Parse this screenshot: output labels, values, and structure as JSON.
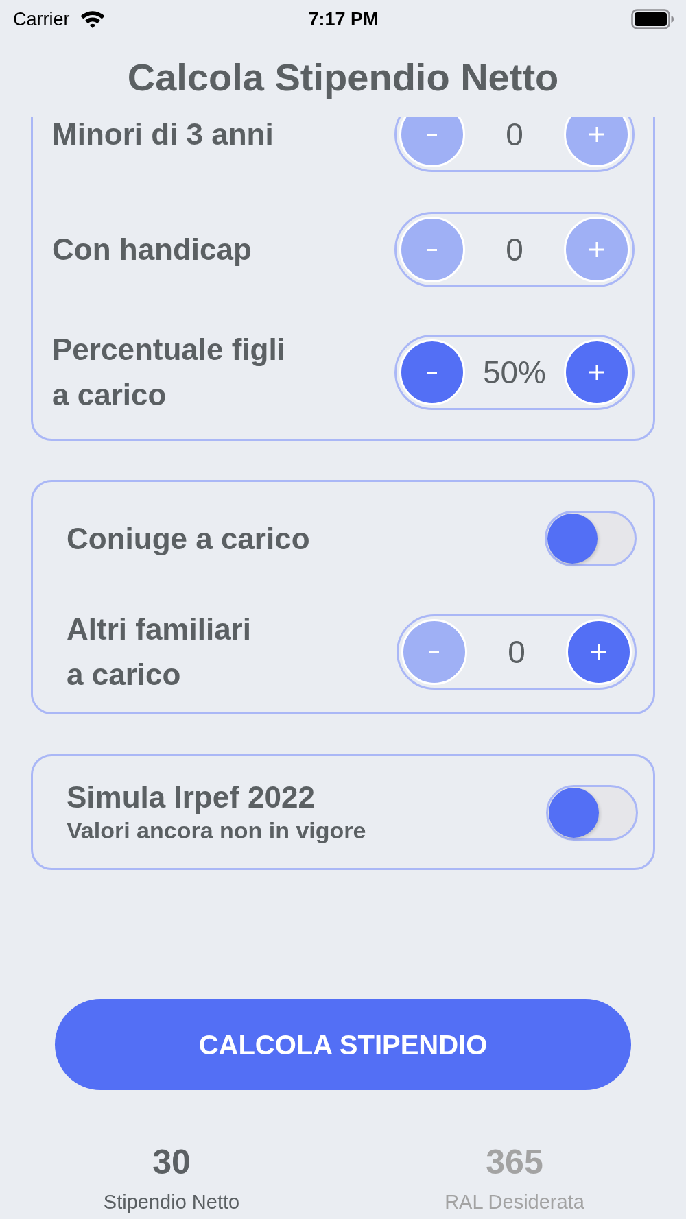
{
  "status_bar": {
    "carrier": "Carrier",
    "time": "7:17 PM"
  },
  "nav_bar": {
    "title": "Calcola Stipendio Netto"
  },
  "children_card": {
    "rows": [
      {
        "label": "Minori di 3 anni",
        "value": "0",
        "minus_disabled": true,
        "plus_disabled": true
      },
      {
        "label": "Con handicap",
        "value": "0",
        "minus_disabled": true,
        "plus_disabled": true
      },
      {
        "label": "Percentuale figli\na carico",
        "value": "50%",
        "minus_disabled": false,
        "plus_disabled": false
      }
    ]
  },
  "family_card": {
    "rows": [
      {
        "kind": "toggle",
        "label": "Coniuge a carico",
        "on": false
      },
      {
        "kind": "stepper",
        "label": "Altri familiari\na carico",
        "value": "0",
        "minus_disabled": true,
        "plus_disabled": false
      }
    ]
  },
  "irpef_card": {
    "title": "Simula Irpef 2022",
    "subtitle": "Valori ancora non in vigore",
    "on": false
  },
  "calculate_button": {
    "label": "CALCOLA STIPENDIO"
  },
  "tabs": [
    {
      "value": "30",
      "label": "Stipendio Netto",
      "selected": true
    },
    {
      "value": "365",
      "label": "RAL Desiderata",
      "selected": false
    }
  ]
}
